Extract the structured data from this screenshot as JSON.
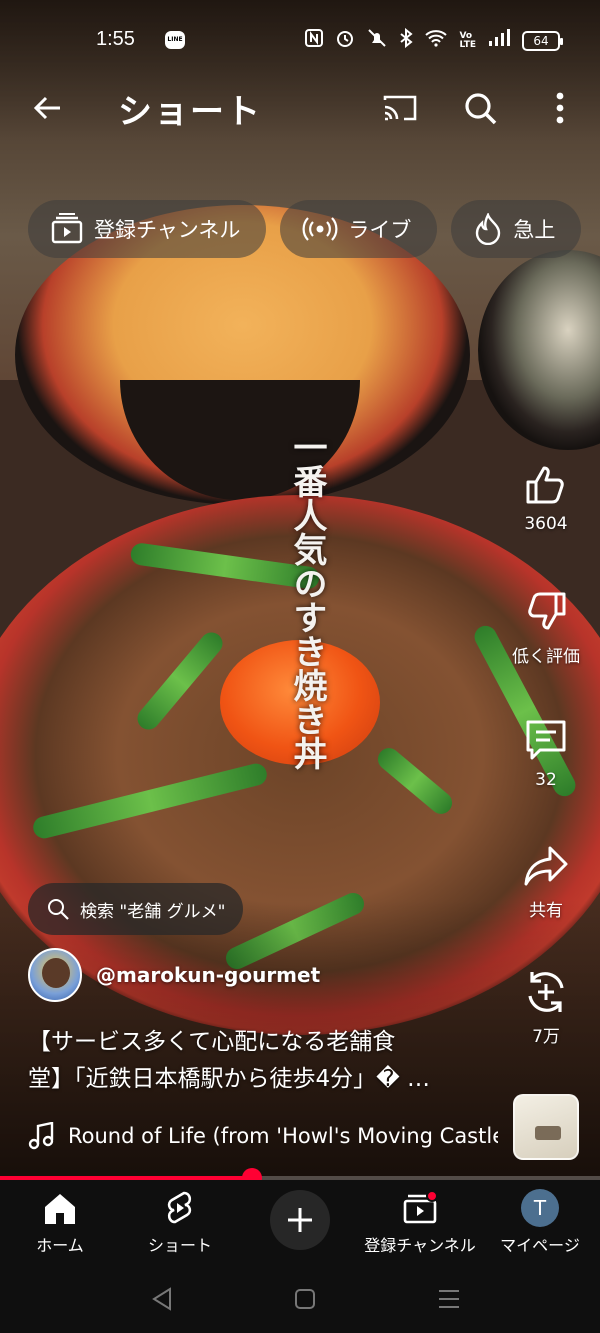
{
  "status_bar": {
    "time": "1:55",
    "notification_app": "LINE",
    "battery": "64",
    "indicators": [
      "nfc-icon",
      "alarm-icon",
      "silent-icon",
      "bluetooth-icon",
      "wifi-icon",
      "volte-icon",
      "signal-icon"
    ]
  },
  "header": {
    "title": "ショート",
    "actions": [
      "cast-icon",
      "search-icon",
      "more-vert-icon"
    ]
  },
  "chips": [
    {
      "label": "登録チャンネル",
      "icon": "subscriptions-icon"
    },
    {
      "label": "ライブ",
      "icon": "live-icon"
    },
    {
      "label": "急上",
      "icon": "trending-icon"
    }
  ],
  "video": {
    "caption": "一番人気のすき焼き丼",
    "search_chip": "検索 \"老舗 グルメ\"",
    "channel_handle": "@marokun-gourmet",
    "description_line1": "【サービス多くて心配になる老舗食",
    "description_line2": "堂】「近鉄日本橋駅から徒歩4分」� …",
    "music": "Round of Life (from 'Howl's Moving Castle",
    "progress": 0.42
  },
  "actions": {
    "like_count": "3604",
    "dislike_label": "低く評価",
    "comment_count": "32",
    "share_label": "共有",
    "remix_count": "7万"
  },
  "bottom_nav": {
    "home": "ホーム",
    "shorts": "ショート",
    "subscriptions": "登録チャンネル",
    "me": "マイページ",
    "me_initial": "T"
  },
  "colors": {
    "accent": "#ff0033",
    "nav_bg": "#0f0f0f"
  }
}
